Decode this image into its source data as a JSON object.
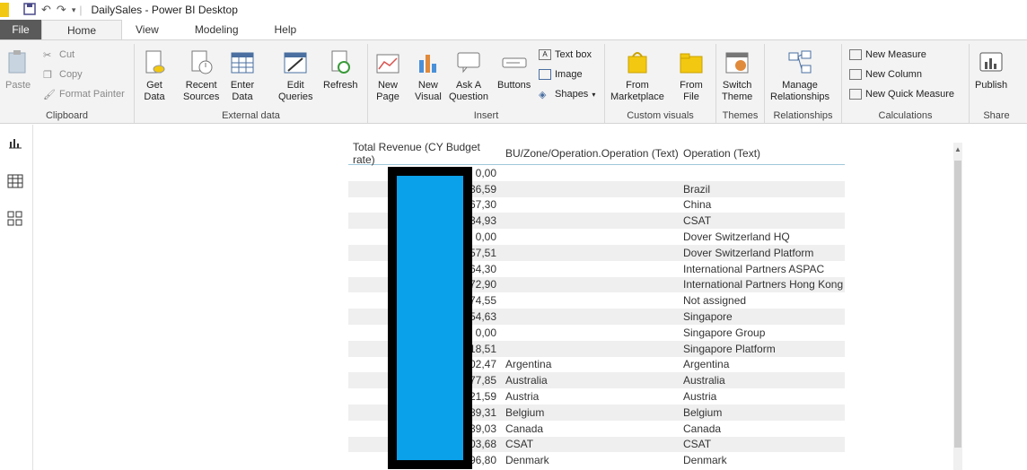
{
  "window": {
    "title": "DailySales - Power BI Desktop"
  },
  "tabs": [
    "File",
    "Home",
    "View",
    "Modeling",
    "Help"
  ],
  "ribbon": {
    "clipboard": {
      "label": "Clipboard",
      "paste": "Paste",
      "cut": "Cut",
      "copy": "Copy",
      "format_painter": "Format Painter"
    },
    "external_data": {
      "label": "External data",
      "get_data": "Get\nData",
      "recent_sources": "Recent\nSources",
      "enter_data": "Enter\nData",
      "edit_queries": "Edit\nQueries",
      "refresh": "Refresh"
    },
    "insert": {
      "label": "Insert",
      "new_page": "New\nPage",
      "new_visual": "New\nVisual",
      "ask_question": "Ask A\nQuestion",
      "buttons": "Buttons",
      "text_box": "Text box",
      "image": "Image",
      "shapes": "Shapes"
    },
    "custom_visuals": {
      "label": "Custom visuals",
      "from_marketplace": "From\nMarketplace",
      "from_file": "From\nFile"
    },
    "themes": {
      "label": "Themes",
      "switch_theme": "Switch\nTheme"
    },
    "relationships": {
      "label": "Relationships",
      "manage": "Manage\nRelationships"
    },
    "calculations": {
      "label": "Calculations",
      "new_measure": "New Measure",
      "new_column": "New Column",
      "new_quick_measure": "New Quick Measure"
    },
    "share": {
      "label": "Share",
      "publish": "Publish"
    }
  },
  "table": {
    "headers": [
      "Total Revenue (CY Budget rate)",
      "BU/Zone/Operation.Operation (Text)",
      "Operation (Text)"
    ],
    "rows": [
      [
        "0,00",
        "",
        ""
      ],
      [
        "36,59",
        "",
        "Brazil"
      ],
      [
        "67,30",
        "",
        "China"
      ],
      [
        "34,93",
        "",
        "CSAT"
      ],
      [
        "0,00",
        "",
        "Dover Switzerland HQ"
      ],
      [
        "57,51",
        "",
        "Dover Switzerland Platform"
      ],
      [
        "64,30",
        "",
        "International Partners ASPAC"
      ],
      [
        "72,90",
        "",
        "International Partners Hong Kong"
      ],
      [
        "74,55",
        "",
        "Not assigned"
      ],
      [
        "54,63",
        "",
        "Singapore"
      ],
      [
        "0,00",
        "",
        "Singapore Group"
      ],
      [
        "18,51",
        "",
        "Singapore Platform"
      ],
      [
        "02,47",
        "Argentina",
        "Argentina"
      ],
      [
        "77,85",
        "Australia",
        "Australia"
      ],
      [
        "21,59",
        "Austria",
        "Austria"
      ],
      [
        "89,31",
        "Belgium",
        "Belgium"
      ],
      [
        "39,03",
        "Canada",
        "Canada"
      ],
      [
        "03,68",
        "CSAT",
        "CSAT"
      ],
      [
        "96,80",
        "Denmark",
        "Denmark"
      ]
    ]
  }
}
